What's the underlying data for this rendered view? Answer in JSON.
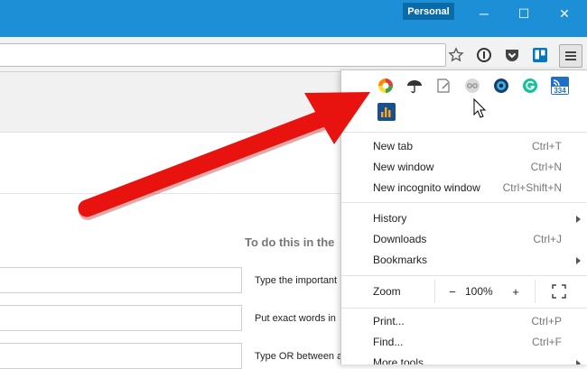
{
  "window": {
    "persona_label": "Personal",
    "controls": {
      "minimize": "─",
      "maximize": "☐",
      "close": "✕"
    }
  },
  "toolbar": {
    "icons": [
      "star-icon",
      "info-icon",
      "pocket-icon",
      "trello-icon",
      "menu-icon"
    ]
  },
  "page": {
    "section_title": "To do this in the",
    "hints": [
      "Type the important",
      "Put exact words in",
      "Type OR between al"
    ]
  },
  "menu": {
    "extension_icons": [
      "colorful-circle-icon",
      "umbrella-icon",
      "note-icon",
      "glasses-icon",
      "eye-icon",
      "grammarly-icon",
      "feed-counter-icon",
      "analytics-icon"
    ],
    "feed_count": "334",
    "items_group1": [
      {
        "label": "New tab",
        "shortcut": "Ctrl+T"
      },
      {
        "label": "New window",
        "shortcut": "Ctrl+N"
      },
      {
        "label": "New incognito window",
        "shortcut": "Ctrl+Shift+N"
      }
    ],
    "items_group2": [
      {
        "label": "History",
        "shortcut": "",
        "submenu": true
      },
      {
        "label": "Downloads",
        "shortcut": "Ctrl+J",
        "submenu": false
      },
      {
        "label": "Bookmarks",
        "shortcut": "",
        "submenu": true
      }
    ],
    "zoom": {
      "label": "Zoom",
      "minus": "−",
      "value": "100%",
      "plus": "+"
    },
    "items_group3": [
      {
        "label": "Print...",
        "shortcut": "Ctrl+P"
      },
      {
        "label": "Find...",
        "shortcut": "Ctrl+F"
      },
      {
        "label": "More tools"
      }
    ]
  },
  "colors": {
    "titlebar": "#1d8fd6",
    "persona": "#0b6aa8",
    "arrow": "#e8130f"
  }
}
